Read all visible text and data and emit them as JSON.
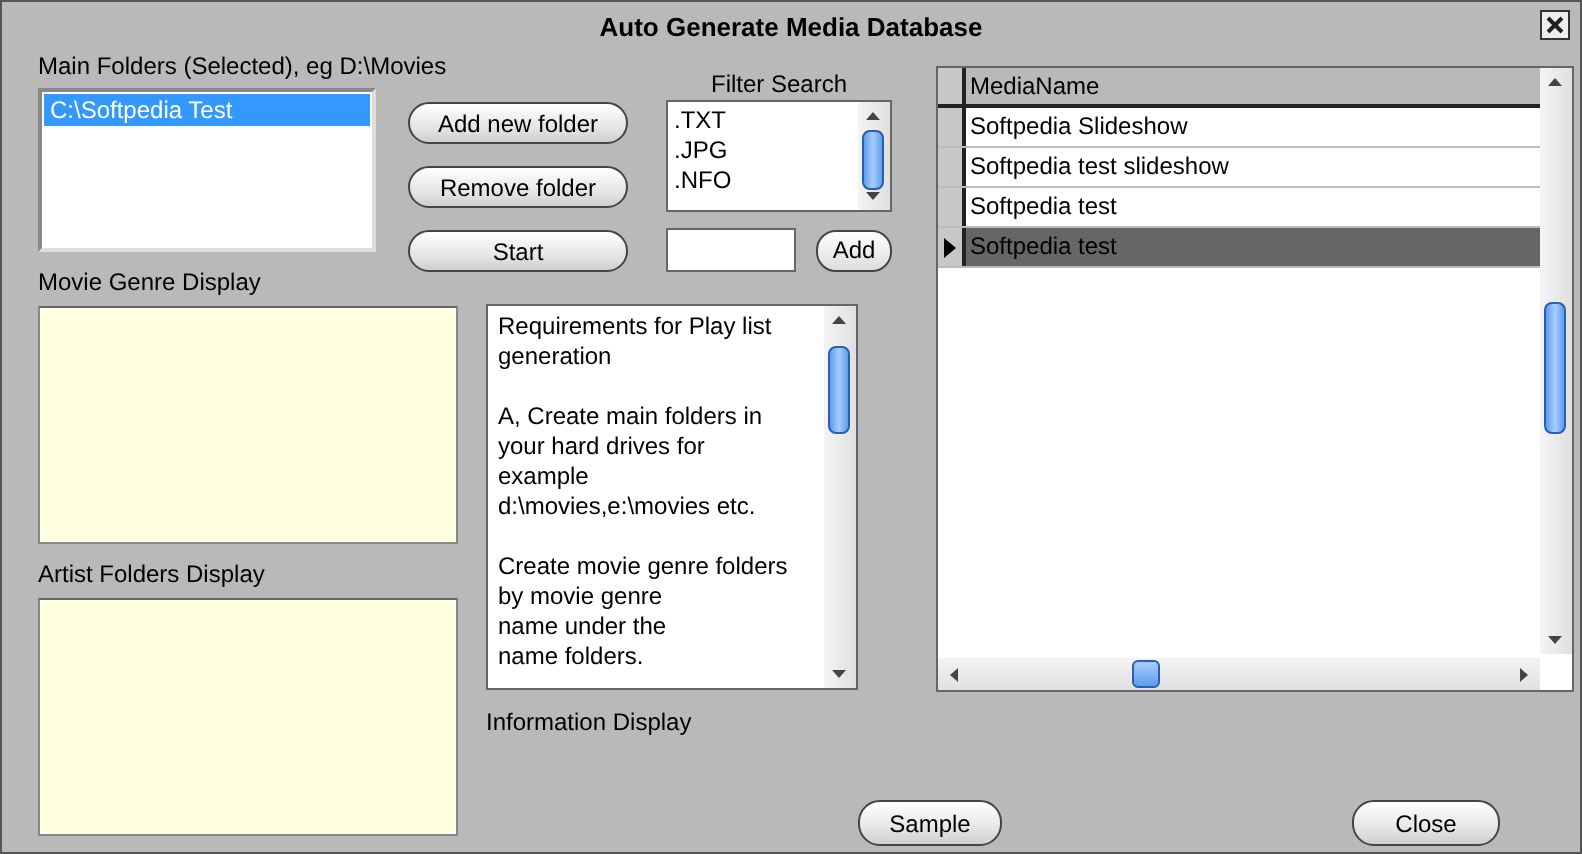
{
  "window": {
    "title": "Auto Generate Media Database"
  },
  "main_folders": {
    "label": "Main Folders (Selected), eg D:\\Movies",
    "items": [
      {
        "text": "C:\\Softpedia Test",
        "selected": true
      }
    ]
  },
  "folder_buttons": [
    "Add new folder",
    "Remove folder",
    "Start"
  ],
  "filter": {
    "label": "Filter Search",
    "items": [
      ".TXT",
      ".JPG",
      ".NFO"
    ],
    "add_button": "Add"
  },
  "genre_display": {
    "label": "Movie Genre Display"
  },
  "artist_display": {
    "label": "Artist Folders Display"
  },
  "information": {
    "paragraphs": [
      "Requirements for Play list\ngeneration",
      "A,  Create main folders in\nyour hard drives for\nexample\nd:\\movies,e:\\movies etc.",
      "Create movie genre folders\nby movie genre\nname under the\nname folders."
    ],
    "label": "Information Display"
  },
  "media_table": {
    "columns": [
      "MediaName"
    ],
    "rows": [
      {
        "name": "Softpedia Slideshow",
        "selected": false
      },
      {
        "name": "Softpedia test slideshow",
        "selected": false
      },
      {
        "name": "Softpedia test",
        "selected": false
      },
      {
        "name": "Softpedia test",
        "selected": true
      }
    ]
  },
  "bottom_buttons": [
    "Sample",
    "Close"
  ]
}
